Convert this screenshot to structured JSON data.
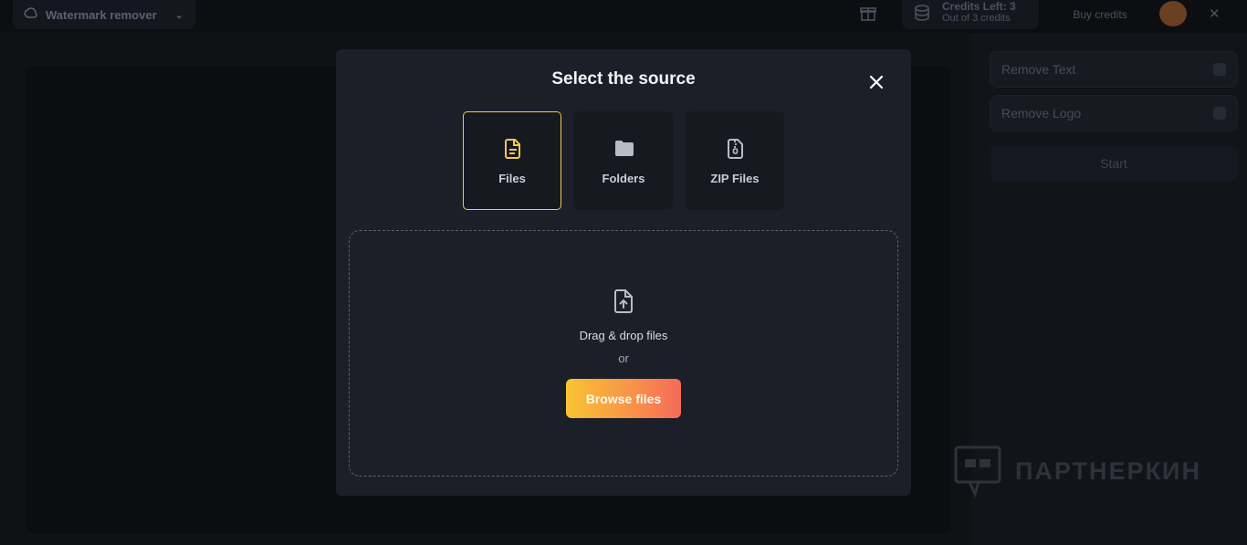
{
  "app": {
    "tab_title": "Watermark remover",
    "credits_title": "Credits Left: 3",
    "credits_sub": "Out of 3 credits",
    "buy_label": "Buy credits"
  },
  "right_panel": {
    "options": [
      "Remove Text",
      "Remove Logo"
    ],
    "start_label": "Start"
  },
  "watermark_text": "ПАРТНЕРКИН",
  "modal": {
    "title": "Select the source",
    "sources": [
      {
        "label": "Files",
        "icon": "file-icon",
        "active": true
      },
      {
        "label": "Folders",
        "icon": "folder-icon",
        "active": false
      },
      {
        "label": "ZIP Files",
        "icon": "zip-file-icon",
        "active": false
      }
    ],
    "dropzone": {
      "text": "Drag & drop files",
      "or": "or",
      "browse_label": "Browse files"
    }
  },
  "colors": {
    "accent": "#f2c94c",
    "button_gradient_start": "#f8c433",
    "button_gradient_end": "#f56a5a",
    "modal_bg": "#1c1f27"
  }
}
